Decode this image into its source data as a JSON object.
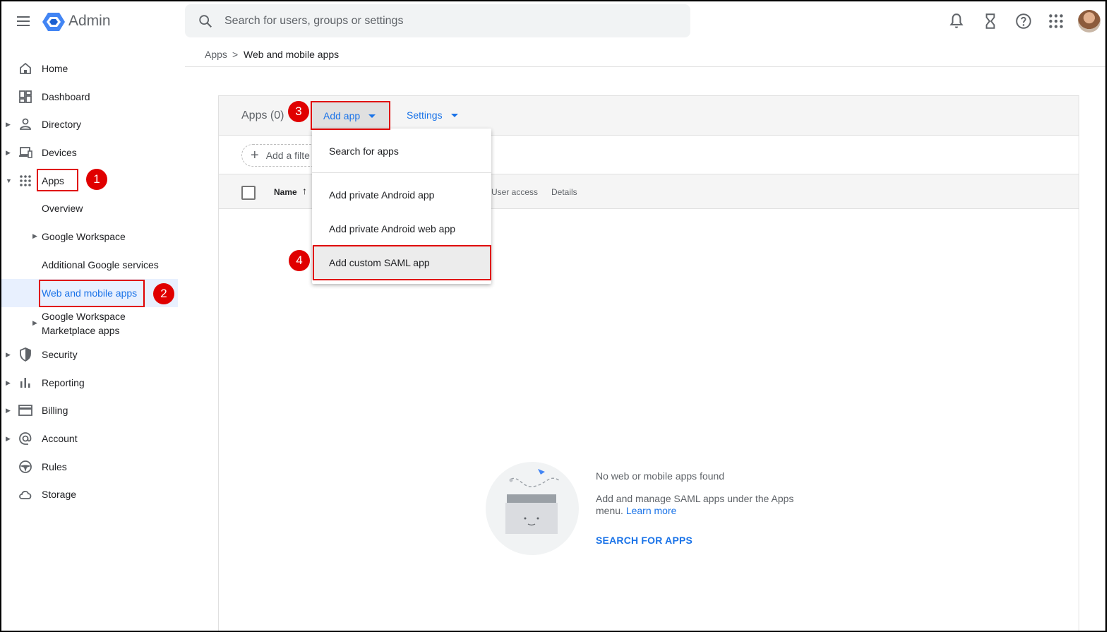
{
  "app": {
    "title": "Admin"
  },
  "search": {
    "placeholder": "Search for users, groups or settings"
  },
  "topbar": {
    "icons": [
      "bell-icon",
      "hourglass-icon",
      "help-icon",
      "apps-grid-icon"
    ]
  },
  "sidebar": {
    "items": [
      {
        "label": "Home",
        "icon": "home-icon"
      },
      {
        "label": "Dashboard",
        "icon": "dashboard-icon"
      },
      {
        "label": "Directory",
        "icon": "person-icon"
      },
      {
        "label": "Devices",
        "icon": "devices-icon"
      },
      {
        "label": "Apps",
        "icon": "apps-grid-icon"
      },
      {
        "label": "Security",
        "icon": "shield-icon"
      },
      {
        "label": "Reporting",
        "icon": "bar-chart-icon"
      },
      {
        "label": "Billing",
        "icon": "credit-card-icon"
      },
      {
        "label": "Account",
        "icon": "at-sign-icon"
      },
      {
        "label": "Rules",
        "icon": "steering-wheel-icon"
      },
      {
        "label": "Storage",
        "icon": "cloud-icon"
      }
    ],
    "apps_children": [
      {
        "label": "Overview"
      },
      {
        "label": "Google Workspace"
      },
      {
        "label": "Additional Google services"
      },
      {
        "label": "Web and mobile apps"
      },
      {
        "label": "Google Workspace",
        "label2": "Marketplace apps"
      }
    ]
  },
  "breadcrumb": {
    "root": "Apps",
    "separator": ">",
    "current": "Web and mobile apps"
  },
  "panel": {
    "title": "Apps (0)",
    "add_app": "Add app",
    "settings": "Settings",
    "add_filter": "Add a filte",
    "columns": {
      "name": "Name",
      "sort_arrow": "↑",
      "user_access": "User access",
      "details": "Details"
    }
  },
  "dropdown": {
    "items": [
      {
        "label": "Search for apps"
      },
      {
        "label": "Add private Android app"
      },
      {
        "label": "Add private Android web app"
      },
      {
        "label": "Add custom SAML app"
      }
    ]
  },
  "empty_state": {
    "title": "No web or mobile apps found",
    "desc": "Add and manage SAML apps under the Apps menu.",
    "learn_more": "Learn more",
    "action": "SEARCH FOR APPS"
  },
  "annotations": {
    "step1": "1",
    "step2": "2",
    "step3": "3",
    "step4": "4"
  },
  "colors": {
    "accent": "#1a73e8",
    "annotation": "#e00000",
    "active_bg": "#e8f0fe"
  }
}
